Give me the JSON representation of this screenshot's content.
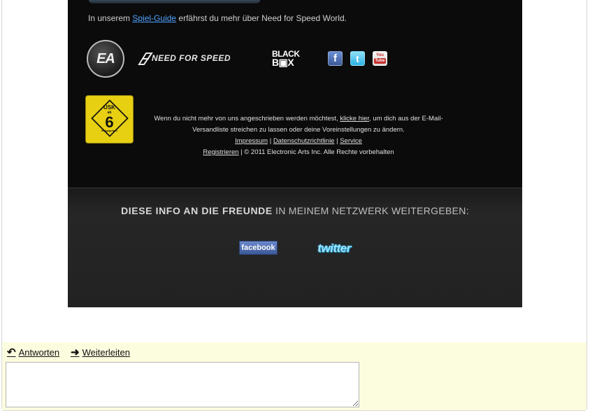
{
  "email": {
    "guide_before": "In unserem ",
    "guide_link": "Spiel-Guide",
    "guide_after": " erfährst du mehr über Need for Speed World.",
    "logos": {
      "ea": "EA",
      "nfs": "NEED FOR SPEED",
      "blackbox_1": "BLACK",
      "blackbox_2": "B▣X"
    },
    "social_icons": [
      {
        "name": "facebook-icon",
        "glyph": "f",
        "color": "#3b5998"
      },
      {
        "name": "twitter-icon",
        "glyph": "t",
        "color": "#2ab2e6"
      },
      {
        "name": "youtube-icon",
        "glyph_top": "You",
        "glyph_bottom": "Tube",
        "color": "#c4302b"
      }
    ],
    "usk": {
      "line1": "USK",
      "line2": "ab",
      "age": "6",
      "line3": "freigegeben"
    },
    "footer": {
      "unsub_before": "Wenn du nicht mehr von uns angeschrieben werden möchtest, ",
      "unsub_link": "klicke hier",
      "unsub_after": ", um dich aus der E-Mail-Versandliste streichen zu lassen oder deine Voreinstellungen zu ändern.",
      "impressum": "Impressum",
      "datenschutz": "Datenschutzrichtlinie",
      "service": "Service",
      "registrieren": "Registrieren",
      "copyright": " | © 2011 Electronic Arts Inc. Alle Rechte vorbehalten",
      "sep": " | "
    },
    "share": {
      "title_bold": "DIESE INFO AN DIE FREUNDE",
      "title_rest": " IN MEINEM NETZWERK WEITERGEBEN:",
      "facebook_label": "facebook",
      "twitter_label": "twitter"
    }
  },
  "actions": {
    "reply_label": "Antworten",
    "forward_label": "Weiterleiten",
    "reply_icon": "↶",
    "forward_icon": "➜"
  },
  "reply_box": {
    "value": "",
    "placeholder": ""
  },
  "colors": {
    "email_bg": "#0b0b0b",
    "link_blue": "#4fa3ff",
    "reply_bar": "#fcfcdf",
    "usk_yellow": "#e7cf12"
  }
}
